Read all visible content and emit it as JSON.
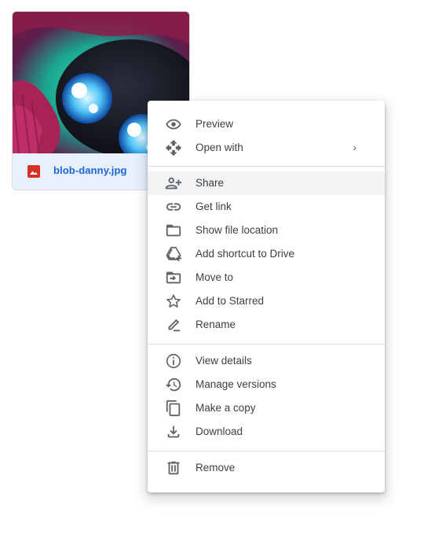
{
  "file": {
    "name": "blob-danny.jpg",
    "type_icon": "image-file-icon",
    "type_color": "#d93025"
  },
  "menu": {
    "groups": [
      [
        {
          "label": "Preview",
          "icon": "eye-icon"
        },
        {
          "label": "Open with",
          "icon": "open-with-icon",
          "submenu": true
        }
      ],
      [
        {
          "label": "Share",
          "icon": "add-person-icon",
          "hovered": true
        },
        {
          "label": "Get link",
          "icon": "link-icon"
        },
        {
          "label": "Show file location",
          "icon": "folder-icon"
        },
        {
          "label": "Add shortcut to Drive",
          "icon": "drive-shortcut-icon"
        },
        {
          "label": "Move to",
          "icon": "move-to-folder-icon"
        },
        {
          "label": "Add to Starred",
          "icon": "star-icon"
        },
        {
          "label": "Rename",
          "icon": "pencil-icon"
        }
      ],
      [
        {
          "label": "View details",
          "icon": "info-icon"
        },
        {
          "label": "Manage versions",
          "icon": "history-icon"
        },
        {
          "label": "Make a copy",
          "icon": "copy-icon"
        },
        {
          "label": "Download",
          "icon": "download-icon"
        }
      ],
      [
        {
          "label": "Remove",
          "icon": "trash-icon"
        }
      ]
    ],
    "submenu_glyph": "›"
  },
  "colors": {
    "accent": "#1967d2",
    "icon": "#5f6368",
    "text": "#3c4043",
    "hover": "#f1f3f4",
    "card_bg": "#e8f0fe"
  }
}
